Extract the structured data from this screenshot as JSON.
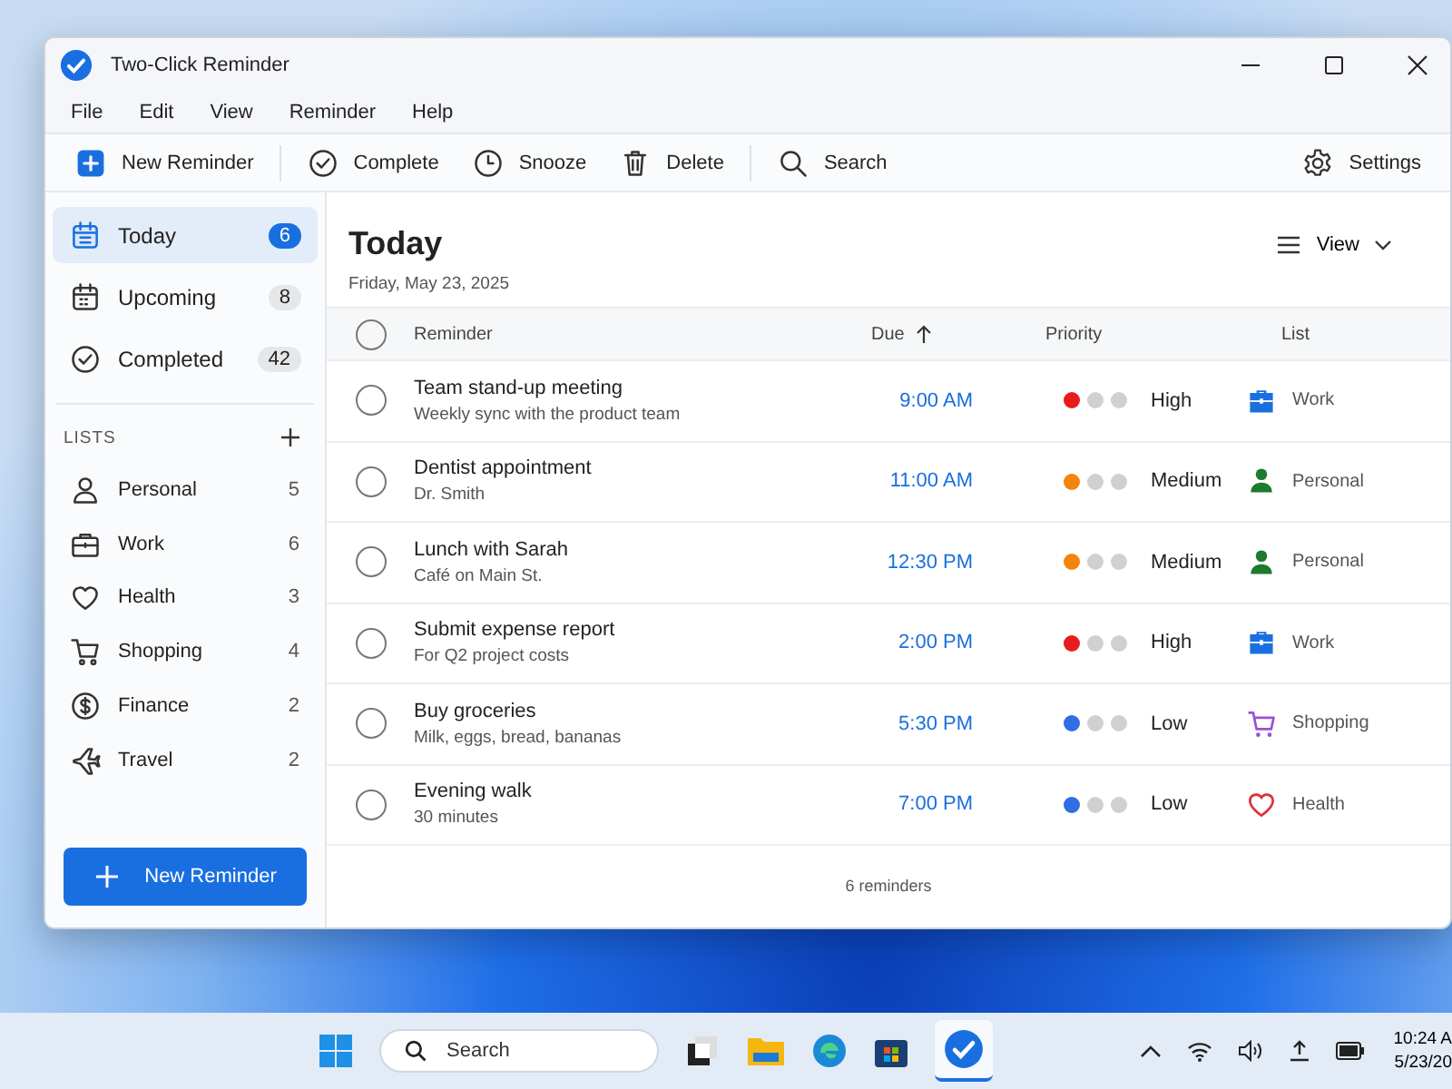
{
  "window": {
    "title": "Two-Click Reminder"
  },
  "menu": [
    "File",
    "Edit",
    "View",
    "Reminder",
    "Help"
  ],
  "toolbar": [
    {
      "label": "New Reminder",
      "kind": "new"
    },
    {
      "label": "Complete",
      "kind": "complete"
    },
    {
      "label": "Snooze",
      "kind": "snooze"
    },
    {
      "label": "Delete",
      "kind": "delete"
    },
    {
      "label": "Search",
      "kind": "search"
    }
  ],
  "settings": "Settings",
  "nav": [
    {
      "label": "Today",
      "count": "6",
      "selected": true,
      "kind": "today"
    },
    {
      "label": "Upcoming",
      "count": "8",
      "selected": false,
      "kind": "upcoming"
    },
    {
      "label": "Completed",
      "count": "42",
      "selected": false,
      "kind": "completed"
    }
  ],
  "lists_heading": "LISTS",
  "lists": [
    {
      "label": "Personal",
      "count": "5",
      "kind": "person"
    },
    {
      "label": "Work",
      "count": "6",
      "kind": "work"
    },
    {
      "label": "Health",
      "count": "3",
      "kind": "health"
    },
    {
      "label": "Shopping",
      "count": "4",
      "kind": "shopping"
    },
    {
      "label": "Finance",
      "count": "2",
      "kind": "finance"
    },
    {
      "label": "Travel",
      "count": "2",
      "kind": "travel"
    }
  ],
  "new_button": "New Reminder",
  "header": {
    "title": "Today",
    "date": "Friday, May 23, 2025",
    "view": "View"
  },
  "select_all": {
    "checked": false
  },
  "columns": [
    {
      "label": "Reminder",
      "sorted": false
    },
    {
      "label": "Due",
      "sorted": true
    },
    {
      "label": "Priority",
      "sorted": false
    },
    {
      "label": "List",
      "sorted": false
    }
  ],
  "rows": [
    {
      "title": "Team stand-up meeting",
      "note": "Weekly sync with the product team",
      "due": "9:00 AM",
      "checked": false,
      "priority": {
        "label": "High",
        "color": "#e81c1c"
      },
      "list": {
        "label": "Work",
        "kind": "work",
        "color": "#1a6fe0"
      }
    },
    {
      "title": "Dentist appointment",
      "note": "Dr. Smith",
      "due": "11:00 AM",
      "checked": false,
      "priority": {
        "label": "Medium",
        "color": "#f5840c"
      },
      "list": {
        "label": "Personal",
        "kind": "person",
        "color": "#1e7a2e"
      }
    },
    {
      "title": "Lunch with Sarah",
      "note": "Café on Main St.",
      "due": "12:30 PM",
      "checked": false,
      "priority": {
        "label": "Medium",
        "color": "#f5840c"
      },
      "list": {
        "label": "Personal",
        "kind": "person",
        "color": "#1e7a2e"
      }
    },
    {
      "title": "Submit expense report",
      "note": "For Q2 project costs",
      "due": "2:00 PM",
      "checked": false,
      "priority": {
        "label": "High",
        "color": "#e81c1c"
      },
      "list": {
        "label": "Work",
        "kind": "work",
        "color": "#1a6fe0"
      }
    },
    {
      "title": "Buy groceries",
      "note": "Milk, eggs, bread, bananas",
      "due": "5:30 PM",
      "checked": false,
      "priority": {
        "label": "Low",
        "color": "#2f6fe4"
      },
      "list": {
        "label": "Shopping",
        "kind": "shopping",
        "color": "#9b4fd6"
      }
    },
    {
      "title": "Evening walk",
      "note": "30 minutes",
      "due": "7:00 PM",
      "checked": false,
      "priority": {
        "label": "Low",
        "color": "#2f6fe4"
      },
      "list": {
        "label": "Health",
        "kind": "health",
        "color": "#e0303a"
      }
    }
  ],
  "footer": "6 reminders",
  "taskbar": {
    "search": "Search",
    "time": "10:24 A",
    "date": "5/23/20"
  }
}
